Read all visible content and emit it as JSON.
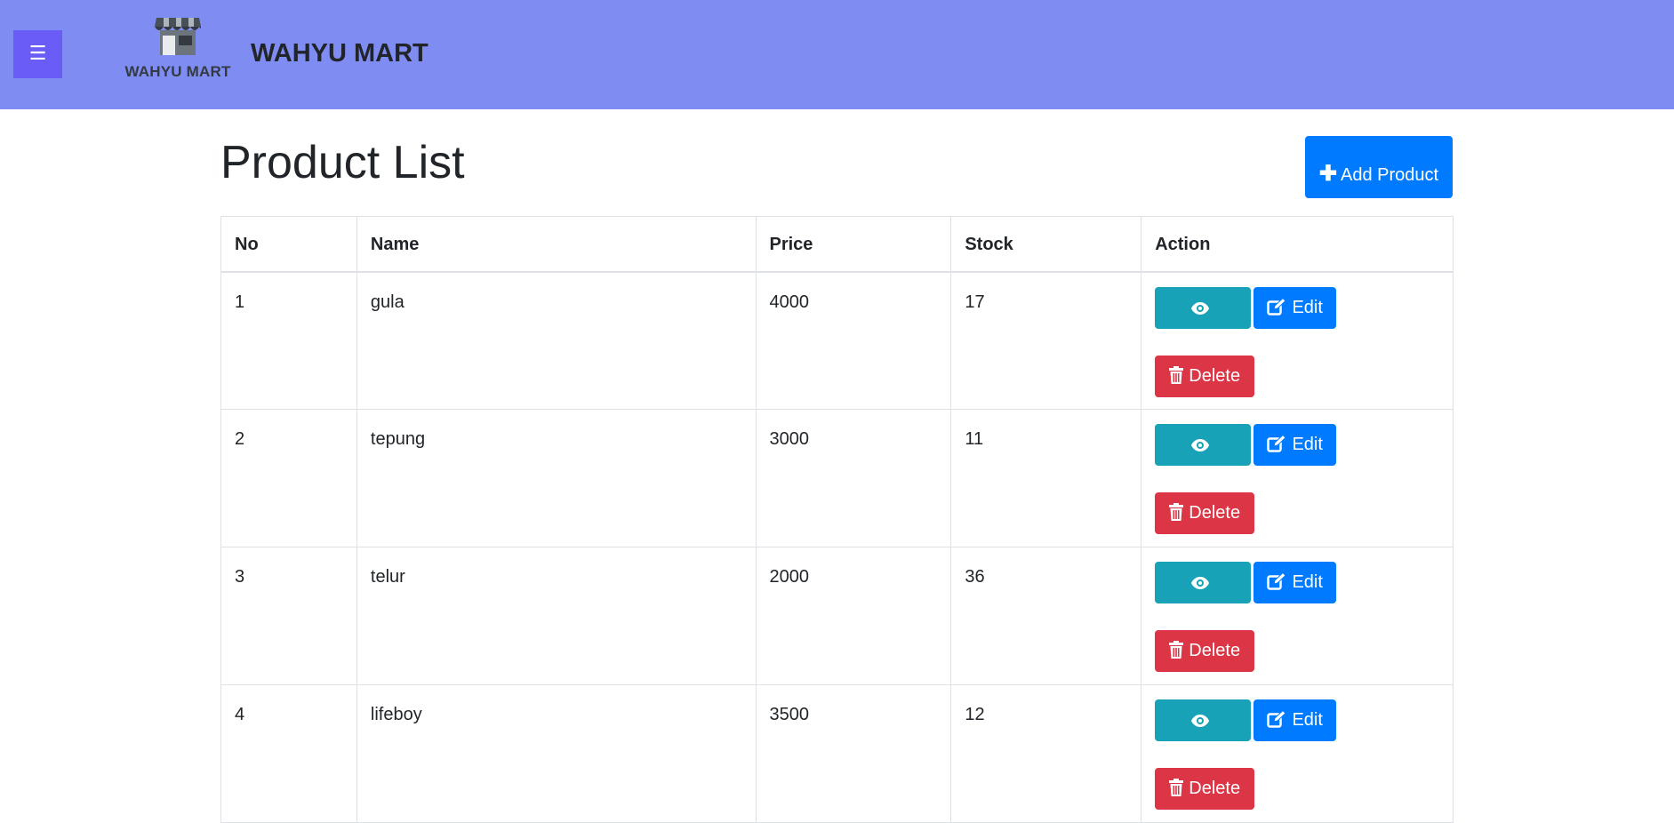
{
  "navbar": {
    "menu_icon": "☰",
    "logo_text": "WAHYU MART",
    "brand": "WAHYU MART",
    "color": "#7f8cf2"
  },
  "page": {
    "title": "Product List",
    "add_button_label": "Add Product"
  },
  "table": {
    "headers": [
      "No",
      "Name",
      "Price",
      "Stock",
      "Action"
    ],
    "rows": [
      {
        "no": "1",
        "name": "gula",
        "price": "4000",
        "stock": "17"
      },
      {
        "no": "2",
        "name": "tepung",
        "price": "3000",
        "stock": "11"
      },
      {
        "no": "3",
        "name": "telur",
        "price": "2000",
        "stock": "36"
      },
      {
        "no": "4",
        "name": "lifeboy",
        "price": "3500",
        "stock": "12"
      }
    ],
    "actions": {
      "show": "Show",
      "edit": "Edit",
      "delete": "Delete"
    }
  },
  "colors": {
    "show": "#17a2b8",
    "edit": "#007bff",
    "delete": "#dc3545",
    "primary": "#007bff"
  }
}
